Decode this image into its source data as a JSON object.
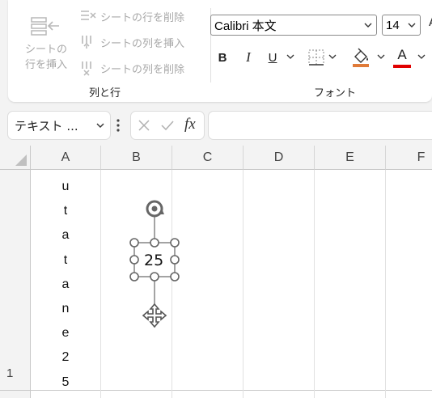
{
  "ribbon": {
    "cells_group": {
      "label": "列と行",
      "insert_sheet_rows_big": "シートの行を挿入",
      "delete_sheet_rows": "シートの行を削除",
      "insert_sheet_columns": "シートの列を挿入",
      "delete_sheet_columns": "シートの列を削除"
    },
    "font_group": {
      "label": "フォント",
      "font_name": "Calibri 本文",
      "font_size": "14",
      "bold": "B",
      "italic": "I",
      "underline": "U",
      "font_color_letter": "A",
      "partial_right": "A",
      "fill_color": "#e07b39",
      "font_color": "#e00000"
    }
  },
  "formula_bar": {
    "name_box": "テキスト ...",
    "fx": "fx",
    "value": ""
  },
  "sheet": {
    "columns": [
      "A",
      "B",
      "C",
      "D",
      "E",
      "F"
    ],
    "rows": [
      "1"
    ],
    "cell_a1_chars": [
      "u",
      "t",
      "a",
      "t",
      "a",
      "n",
      "e",
      "2",
      "5"
    ],
    "textbox_text": "25"
  }
}
